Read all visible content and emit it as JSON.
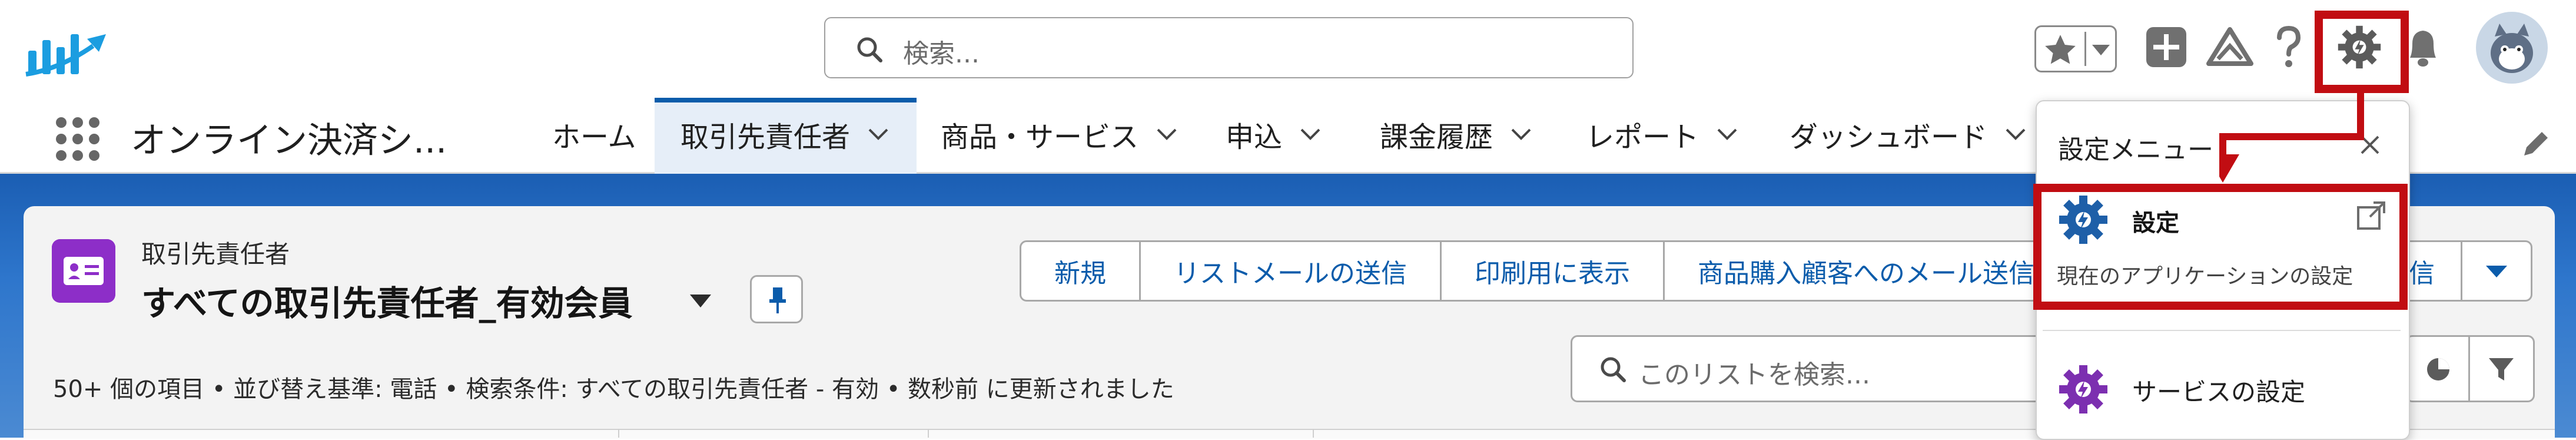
{
  "header": {
    "search_placeholder": "検索...",
    "icons": [
      "app-logo-icon",
      "star-icon",
      "chevron-down-icon",
      "plus-icon",
      "trailhead-icon",
      "help-icon",
      "gear-icon",
      "bell-icon",
      "avatar"
    ]
  },
  "nav": {
    "app_name": "オンライン決済シ...",
    "items": [
      {
        "label": "ホーム",
        "has_menu": false
      },
      {
        "label": "取引先責任者",
        "has_menu": true,
        "active": true
      },
      {
        "label": "商品・サービス",
        "has_menu": true
      },
      {
        "label": "申込",
        "has_menu": true
      },
      {
        "label": "課金履歴",
        "has_menu": true
      },
      {
        "label": "レポート",
        "has_menu": true
      },
      {
        "label": "ダッシュボード",
        "has_menu": true
      }
    ]
  },
  "list_view": {
    "object_label": "取引先責任者",
    "title": "すべての取引先責任者_有効会員",
    "status": "50+ 個の項目 • 並び替え基準: 電話 • 検索条件: すべての取引先責任者 - 有効 • 数秒前 に更新されました",
    "search_placeholder": "このリストを検索...",
    "buttons": [
      "新規",
      "リストメールの送信",
      "印刷用に表示",
      "商品購入顧客へのメール送信"
    ],
    "button_tail": "信"
  },
  "dropdown": {
    "title": "設定メニュー",
    "items": [
      {
        "title": "設定",
        "description": "現在のアプリケーションの設定"
      },
      {
        "title": "サービスの設定"
      }
    ]
  },
  "colors": {
    "brand_blue": "#0b5cab",
    "highlight_red": "#c10d12",
    "contact_purple": "#8d2ec8",
    "setup_icon_blue": "#1e5fa8",
    "service_icon_purple": "#7c2fb0"
  }
}
